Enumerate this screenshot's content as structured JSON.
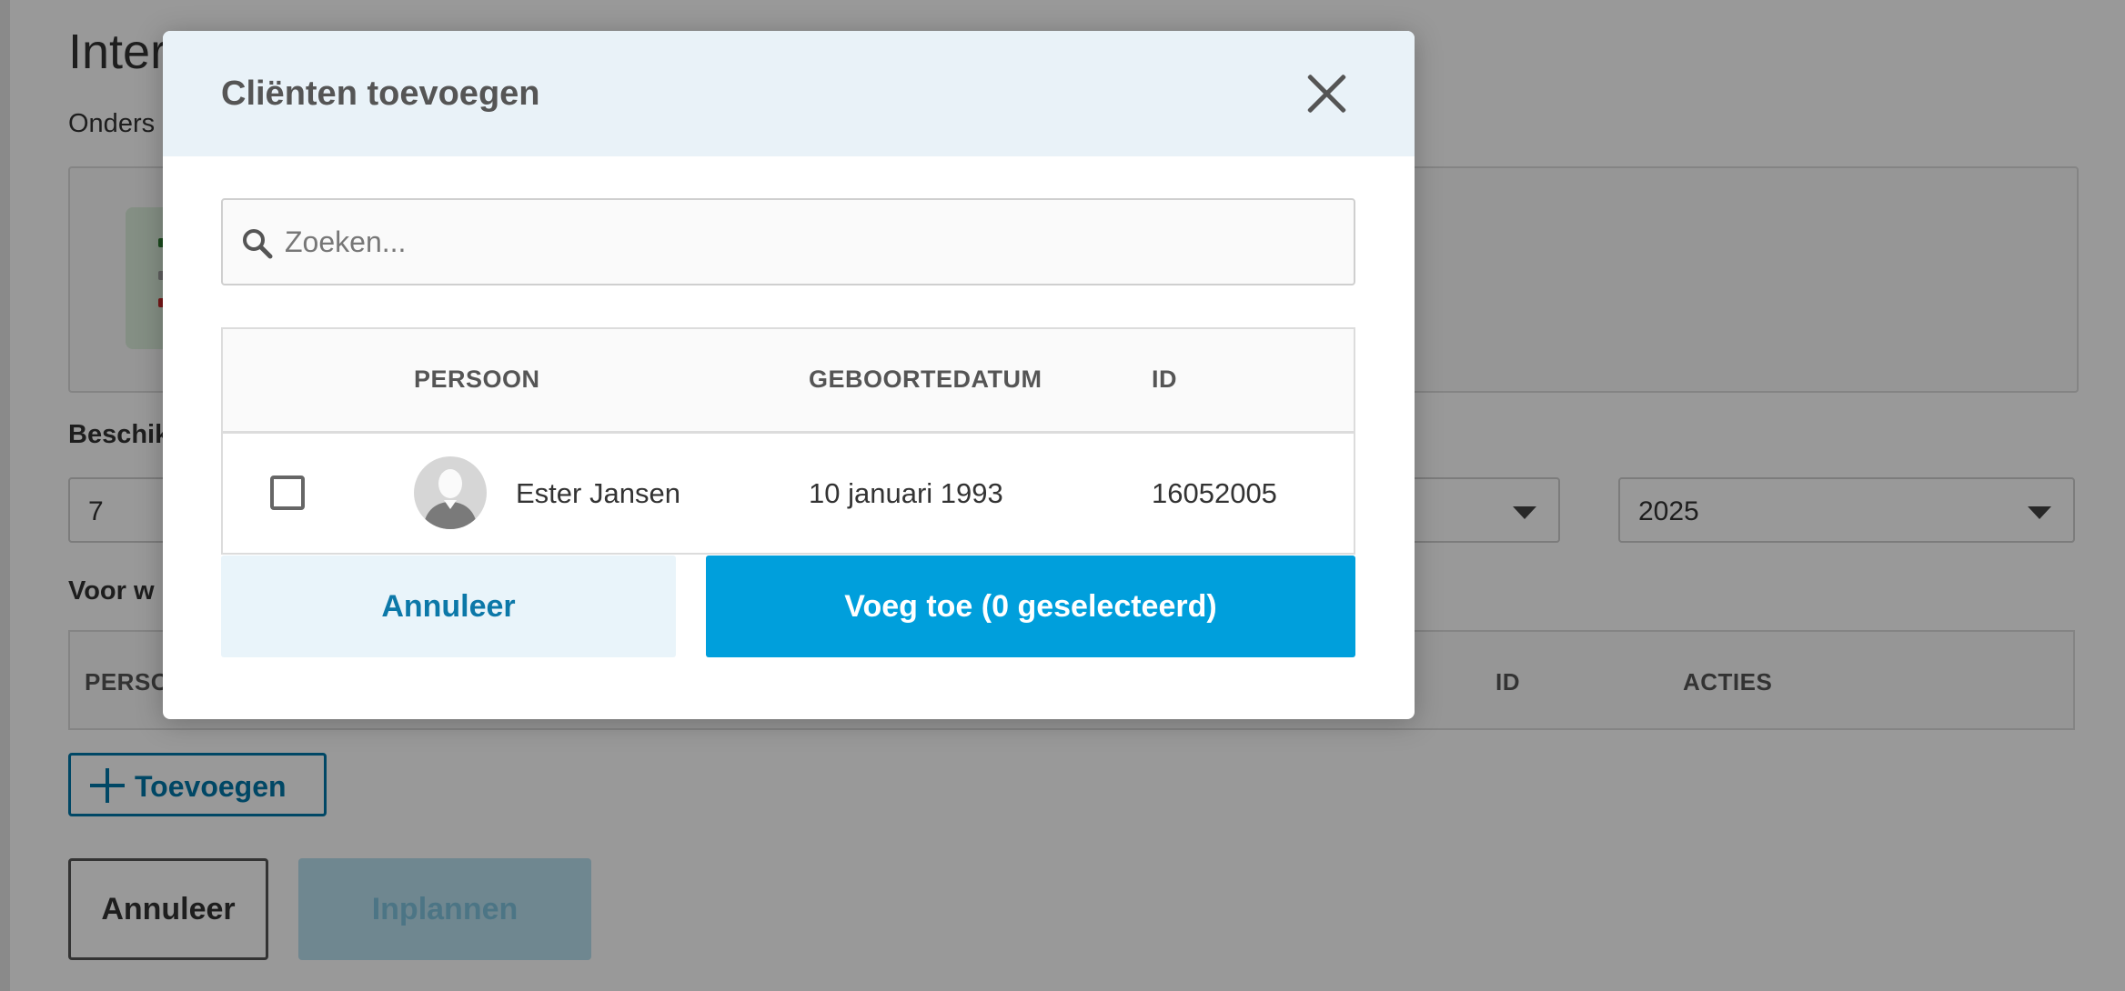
{
  "background": {
    "page_title": "Inter",
    "page_subtitle": "Onders",
    "beschikbaar_label": "Beschik",
    "day_select_value": "7",
    "year_select_value": "2025",
    "voor_label": "Voor w",
    "table_headers": {
      "persoon": "PERSO",
      "id": "ID",
      "acties": "ACTIES"
    },
    "add_button_label": "Toevoegen",
    "cancel_button_label": "Annuleer",
    "plan_button_label": "Inplannen"
  },
  "modal": {
    "title": "Cliënten toevoegen",
    "search_placeholder": "Zoeken...",
    "table": {
      "headers": {
        "persoon": "PERSOON",
        "geboortedatum": "GEBOORTEDATUM",
        "id": "ID"
      },
      "rows": [
        {
          "name": "Ester Jansen",
          "birthdate": "10 januari 1993",
          "id": "16052005",
          "selected": false
        }
      ]
    },
    "cancel_label": "Annuleer",
    "add_label": "Voeg toe (0 geselecteerd)"
  },
  "icons": [
    "close-icon",
    "search-icon",
    "checkbox-icon",
    "avatar-icon",
    "plus-icon",
    "chevron-down-icon"
  ],
  "colors": {
    "primary": "#009fdc",
    "primary_dark": "#0077a8",
    "header_tint": "#e9f2f8",
    "overlay": "rgba(0,0,0,0.40)"
  }
}
